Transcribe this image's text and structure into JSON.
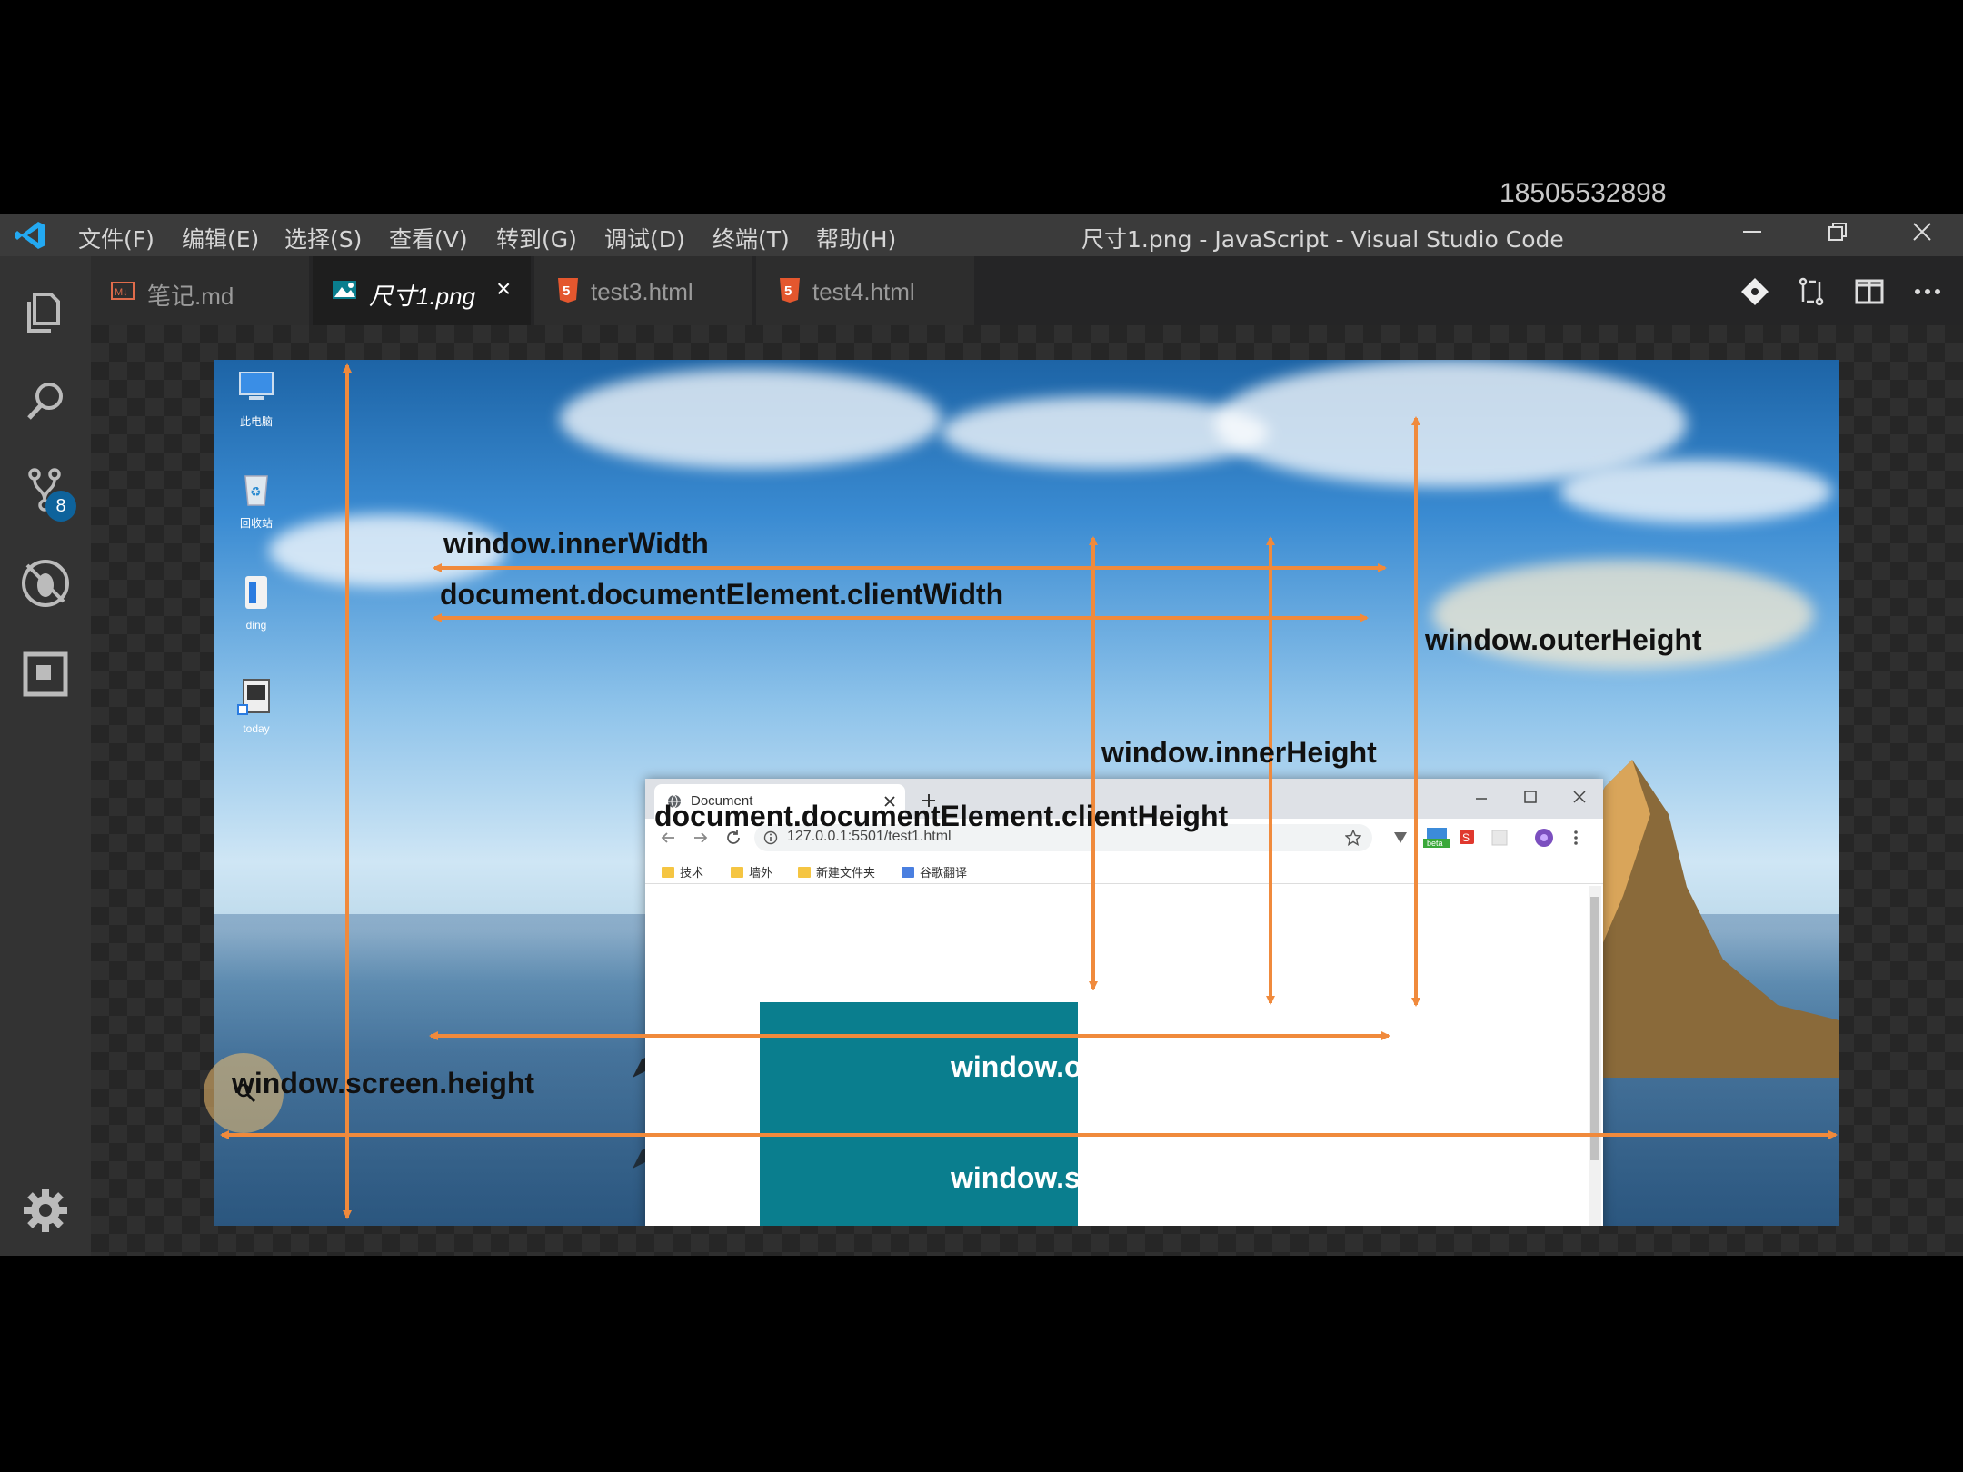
{
  "watermark": "18505532898",
  "titlebar": {
    "menu": [
      "文件(F)",
      "编辑(E)",
      "选择(S)",
      "查看(V)",
      "转到(G)",
      "调试(D)",
      "终端(T)",
      "帮助(H)"
    ],
    "window_title": "尺寸1.png - JavaScript - Visual Studio Code"
  },
  "activity_bar": {
    "icons": [
      "explorer-icon",
      "search-icon",
      "source-control-icon",
      "debug-icon",
      "extensions-icon",
      "settings-gear-icon"
    ],
    "scm_badge": "8"
  },
  "tabs": [
    {
      "label": "笔记.md",
      "icon": "markdown-icon",
      "active": false
    },
    {
      "label": "尺寸1.png",
      "icon": "image-icon",
      "active": true,
      "close": "×"
    },
    {
      "label": "test3.html",
      "icon": "html5-icon",
      "active": false
    },
    {
      "label": "test4.html",
      "icon": "html5-icon",
      "active": false
    }
  ],
  "editor_toolbar": [
    "git-compare-icon",
    "open-changes-icon",
    "split-editor-icon",
    "more-actions-icon"
  ],
  "colors": {
    "accent_orange": "#f08a3c",
    "teal": "#0a7e8e",
    "vscode_blue": "#23a9f2"
  },
  "image": {
    "desktop_icons": [
      "此电脑",
      "回收站",
      "ding",
      "today"
    ],
    "browser": {
      "tab_title": "Document",
      "url": "127.0.0.1:5501/test1.html",
      "bookmarks": [
        "技术",
        "墙外",
        "新建文件夹",
        "谷歌翻译"
      ]
    },
    "labels": {
      "inner_width": "window.innerWidth",
      "client_width": "document.documentElement.clientWidth",
      "outer_height": "window.outerHeight",
      "inner_height": "window.innerHeight",
      "client_height": "document.documentElement.clientHeight",
      "screen_height": "window.screen.height",
      "outer_width": "window.outerWidth",
      "screen_width": "window.screen.width"
    }
  }
}
